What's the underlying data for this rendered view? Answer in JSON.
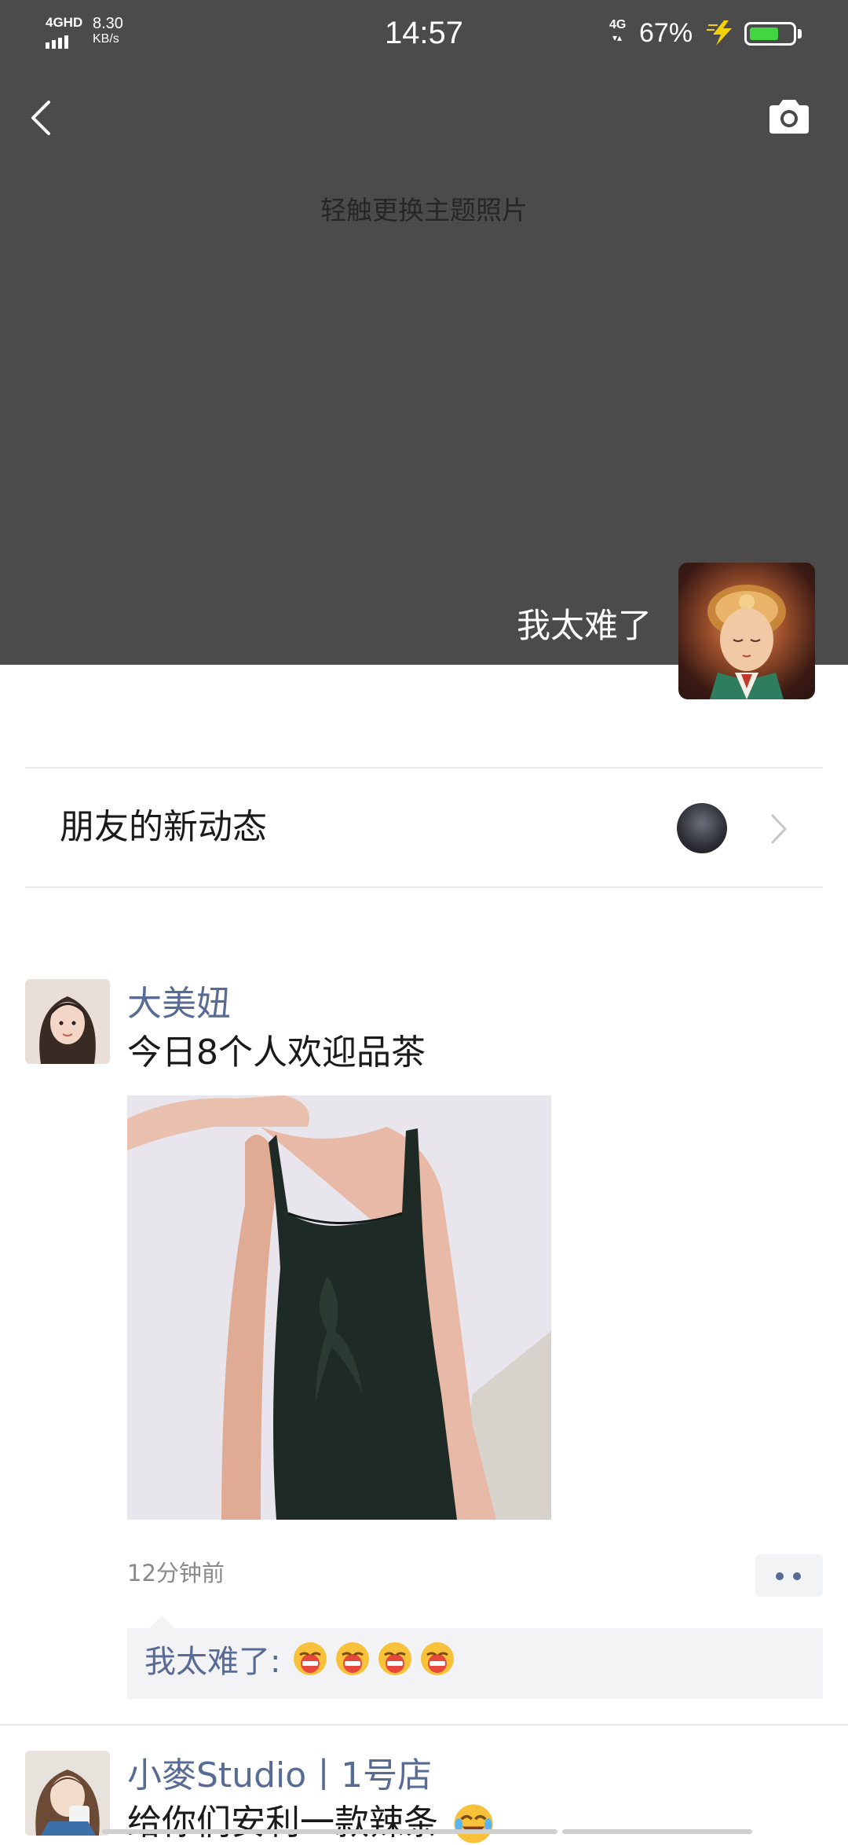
{
  "status_bar": {
    "network": "4GHD",
    "speed": "8.30",
    "speed_unit": "KB/s",
    "time": "14:57",
    "mobile_data": "4G",
    "battery": "67%",
    "battery_level": 0.67,
    "battery_color": "#42d642"
  },
  "header": {
    "back_icon": "chevron-left-icon",
    "camera_icon": "camera-icon",
    "cover_hint": "轻触更换主题照片",
    "cover_color": "#4a4a4a"
  },
  "profile": {
    "name": "我太难了"
  },
  "friends_updates": {
    "label": "朋友的新动态",
    "chevron_icon": "chevron-right-icon"
  },
  "posts": [
    {
      "author": "大美妞",
      "text": "今日8个人欢迎品茶",
      "time": "12分钟前",
      "more_icon": "more-dots-icon",
      "comments": [
        {
          "author": "我太难了:",
          "emojis": [
            "grimace-emoji",
            "grimace-emoji",
            "grimace-emoji",
            "grimace-emoji"
          ]
        }
      ]
    },
    {
      "author": "小麥Studio丨1号店",
      "text": "给你们安利一款辣条",
      "trailing_emoji": "tears-of-joy-emoji"
    }
  ],
  "colors": {
    "link_blue": "#576b95",
    "comment_bg": "#f3f3f5"
  }
}
